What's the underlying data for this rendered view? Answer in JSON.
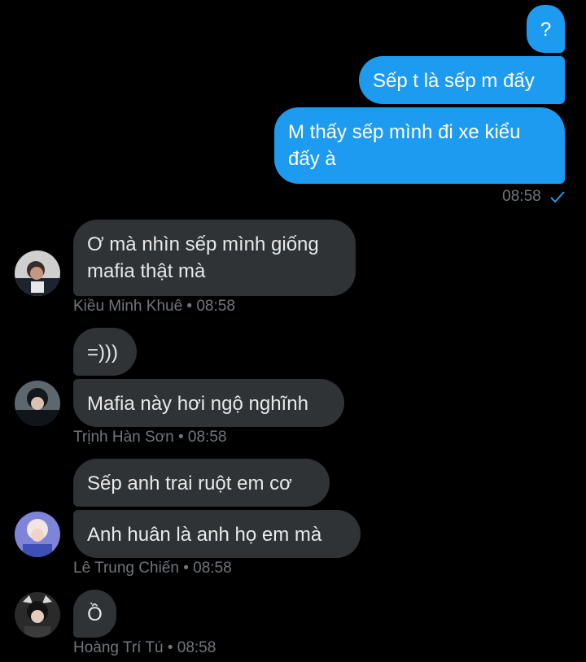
{
  "colors": {
    "background": "#000000",
    "outgoing": "#1d9bf0",
    "incoming": "#2f3336",
    "meta": "#71767b"
  },
  "messages": {
    "out1": "?",
    "out2": "Sếp t là sếp m đấy",
    "out3_line1": "M thấy sếp mình đi xe kiểu",
    "out3_line2": "đấy à",
    "out_time": "08:58",
    "m1_line1": "Ơ mà nhìn sếp mình giống",
    "m1_line2": "mafia thật mà",
    "m1_meta": "Kiều Minh Khuê • 08:58",
    "m2": "=)))",
    "m3": "Mafia này hơi ngộ nghĩnh",
    "m3_meta": "Trịnh Hàn Sơn • 08:58",
    "m4": "Sếp anh trai ruột em cơ",
    "m5": "Anh huân là anh họ em mà",
    "m5_meta": "Lê Trung Chiến • 08:58",
    "m6": "Ồ",
    "m6_meta": "Hoàng Trí Tú • 08:58"
  },
  "icons": {
    "read_receipt": "check-icon"
  }
}
